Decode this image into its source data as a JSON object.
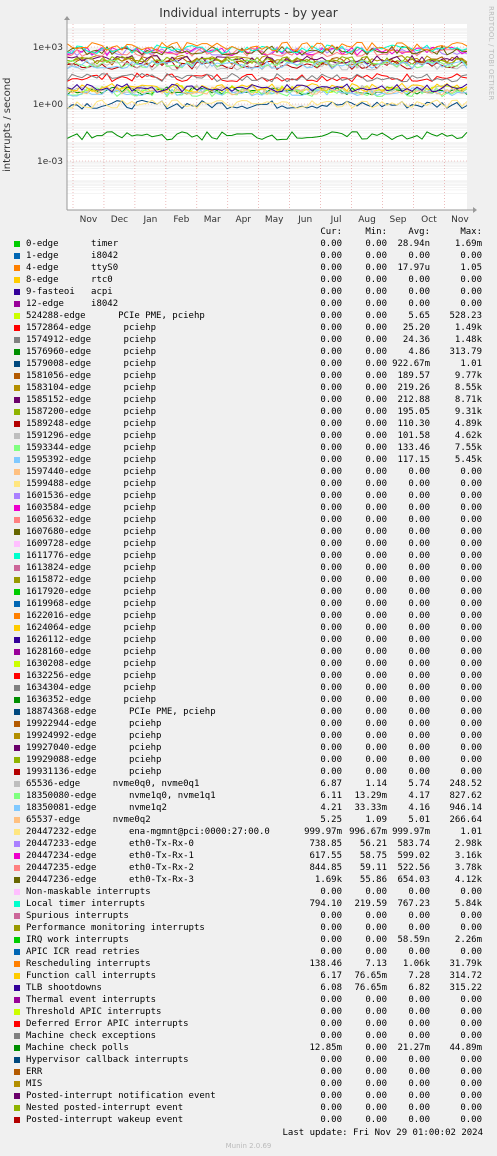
{
  "page": {
    "title": "Individual interrupts - by year",
    "side_text": "RRDTOOL / TOBI OETIKER",
    "last_update": "Last update: Fri Nov 29 01:00:02 2024",
    "munin": "Munin 2.0.69"
  },
  "chart_data": {
    "type": "line",
    "ylabel": "interrupts / second",
    "yscale": "log",
    "yticks": [
      "1e-03",
      "1e+00",
      "1e+03"
    ],
    "xticks": [
      "Nov",
      "Dec",
      "Jan",
      "Feb",
      "Mar",
      "Apr",
      "May",
      "Jun",
      "Jul",
      "Aug",
      "Sep",
      "Oct",
      "Nov"
    ],
    "grid": true,
    "columns": [
      "Cur:",
      "Min:",
      "Avg:",
      "Max:"
    ],
    "series": [
      {
        "name": "0-edge      timer",
        "color": "#00cc00",
        "cur": "0.00",
        "min": "0.00",
        "avg": "28.94n",
        "max": "1.69m"
      },
      {
        "name": "1-edge      i8042",
        "color": "#0066b3",
        "cur": "0.00",
        "min": "0.00",
        "avg": "0.00",
        "max": "0.00"
      },
      {
        "name": "4-edge      ttyS0",
        "color": "#ff8000",
        "cur": "0.00",
        "min": "0.00",
        "avg": "17.97u",
        "max": "1.05"
      },
      {
        "name": "8-edge      rtc0",
        "color": "#ffcc00",
        "cur": "0.00",
        "min": "0.00",
        "avg": "0.00",
        "max": "0.00"
      },
      {
        "name": "9-fasteoi   acpi",
        "color": "#330099",
        "cur": "0.00",
        "min": "0.00",
        "avg": "0.00",
        "max": "0.00"
      },
      {
        "name": "12-edge     i8042",
        "color": "#990099",
        "cur": "0.00",
        "min": "0.00",
        "avg": "0.00",
        "max": "0.00"
      },
      {
        "name": "524288-edge      PCIe PME, pciehp",
        "color": "#ccff00",
        "cur": "0.00",
        "min": "0.00",
        "avg": "5.65",
        "max": "528.23"
      },
      {
        "name": "1572864-edge      pciehp",
        "color": "#ff0000",
        "cur": "0.00",
        "min": "0.00",
        "avg": "25.20",
        "max": "1.49k"
      },
      {
        "name": "1574912-edge      pciehp",
        "color": "#808080",
        "cur": "0.00",
        "min": "0.00",
        "avg": "24.36",
        "max": "1.48k"
      },
      {
        "name": "1576960-edge      pciehp",
        "color": "#008f00",
        "cur": "0.00",
        "min": "0.00",
        "avg": "4.86",
        "max": "313.79"
      },
      {
        "name": "1579008-edge      pciehp",
        "color": "#00487d",
        "cur": "0.00",
        "min": "0.00",
        "avg": "922.67m",
        "max": "1.01"
      },
      {
        "name": "1581056-edge      pciehp",
        "color": "#b35a00",
        "cur": "0.00",
        "min": "0.00",
        "avg": "189.57",
        "max": "9.77k"
      },
      {
        "name": "1583104-edge      pciehp",
        "color": "#b38f00",
        "cur": "0.00",
        "min": "0.00",
        "avg": "219.26",
        "max": "8.55k"
      },
      {
        "name": "1585152-edge      pciehp",
        "color": "#6b006b",
        "cur": "0.00",
        "min": "0.00",
        "avg": "212.88",
        "max": "8.71k"
      },
      {
        "name": "1587200-edge      pciehp",
        "color": "#8fb300",
        "cur": "0.00",
        "min": "0.00",
        "avg": "195.05",
        "max": "9.31k"
      },
      {
        "name": "1589248-edge      pciehp",
        "color": "#b30000",
        "cur": "0.00",
        "min": "0.00",
        "avg": "110.30",
        "max": "4.89k"
      },
      {
        "name": "1591296-edge      pciehp",
        "color": "#bebebe",
        "cur": "0.00",
        "min": "0.00",
        "avg": "101.58",
        "max": "4.62k"
      },
      {
        "name": "1593344-edge      pciehp",
        "color": "#80ff80",
        "cur": "0.00",
        "min": "0.00",
        "avg": "133.46",
        "max": "7.55k"
      },
      {
        "name": "1595392-edge      pciehp",
        "color": "#80c9ff",
        "cur": "0.00",
        "min": "0.00",
        "avg": "117.15",
        "max": "5.45k"
      },
      {
        "name": "1597440-edge      pciehp",
        "color": "#ffc080",
        "cur": "0.00",
        "min": "0.00",
        "avg": "0.00",
        "max": "0.00"
      },
      {
        "name": "1599488-edge      pciehp",
        "color": "#ffe680",
        "cur": "0.00",
        "min": "0.00",
        "avg": "0.00",
        "max": "0.00"
      },
      {
        "name": "1601536-edge      pciehp",
        "color": "#aa80ff",
        "cur": "0.00",
        "min": "0.00",
        "avg": "0.00",
        "max": "0.00"
      },
      {
        "name": "1603584-edge      pciehp",
        "color": "#ee00cc",
        "cur": "0.00",
        "min": "0.00",
        "avg": "0.00",
        "max": "0.00"
      },
      {
        "name": "1605632-edge      pciehp",
        "color": "#ff8080",
        "cur": "0.00",
        "min": "0.00",
        "avg": "0.00",
        "max": "0.00"
      },
      {
        "name": "1607680-edge      pciehp",
        "color": "#666600",
        "cur": "0.00",
        "min": "0.00",
        "avg": "0.00",
        "max": "0.00"
      },
      {
        "name": "1609728-edge      pciehp",
        "color": "#ffbfff",
        "cur": "0.00",
        "min": "0.00",
        "avg": "0.00",
        "max": "0.00"
      },
      {
        "name": "1611776-edge      pciehp",
        "color": "#00ffcc",
        "cur": "0.00",
        "min": "0.00",
        "avg": "0.00",
        "max": "0.00"
      },
      {
        "name": "1613824-edge      pciehp",
        "color": "#cc6699",
        "cur": "0.00",
        "min": "0.00",
        "avg": "0.00",
        "max": "0.00"
      },
      {
        "name": "1615872-edge      pciehp",
        "color": "#999900",
        "cur": "0.00",
        "min": "0.00",
        "avg": "0.00",
        "max": "0.00"
      },
      {
        "name": "1617920-edge      pciehp",
        "color": "#00cc00",
        "cur": "0.00",
        "min": "0.00",
        "avg": "0.00",
        "max": "0.00"
      },
      {
        "name": "1619968-edge      pciehp",
        "color": "#0066b3",
        "cur": "0.00",
        "min": "0.00",
        "avg": "0.00",
        "max": "0.00"
      },
      {
        "name": "1622016-edge      pciehp",
        "color": "#ff8000",
        "cur": "0.00",
        "min": "0.00",
        "avg": "0.00",
        "max": "0.00"
      },
      {
        "name": "1624064-edge      pciehp",
        "color": "#ffcc00",
        "cur": "0.00",
        "min": "0.00",
        "avg": "0.00",
        "max": "0.00"
      },
      {
        "name": "1626112-edge      pciehp",
        "color": "#330099",
        "cur": "0.00",
        "min": "0.00",
        "avg": "0.00",
        "max": "0.00"
      },
      {
        "name": "1628160-edge      pciehp",
        "color": "#990099",
        "cur": "0.00",
        "min": "0.00",
        "avg": "0.00",
        "max": "0.00"
      },
      {
        "name": "1630208-edge      pciehp",
        "color": "#ccff00",
        "cur": "0.00",
        "min": "0.00",
        "avg": "0.00",
        "max": "0.00"
      },
      {
        "name": "1632256-edge      pciehp",
        "color": "#ff0000",
        "cur": "0.00",
        "min": "0.00",
        "avg": "0.00",
        "max": "0.00"
      },
      {
        "name": "1634304-edge      pciehp",
        "color": "#808080",
        "cur": "0.00",
        "min": "0.00",
        "avg": "0.00",
        "max": "0.00"
      },
      {
        "name": "1636352-edge      pciehp",
        "color": "#008f00",
        "cur": "0.00",
        "min": "0.00",
        "avg": "0.00",
        "max": "0.00"
      },
      {
        "name": "18874368-edge      PCIe PME, pciehp",
        "color": "#00487d",
        "cur": "0.00",
        "min": "0.00",
        "avg": "0.00",
        "max": "0.00"
      },
      {
        "name": "19922944-edge      pciehp",
        "color": "#b35a00",
        "cur": "0.00",
        "min": "0.00",
        "avg": "0.00",
        "max": "0.00"
      },
      {
        "name": "19924992-edge      pciehp",
        "color": "#b38f00",
        "cur": "0.00",
        "min": "0.00",
        "avg": "0.00",
        "max": "0.00"
      },
      {
        "name": "19927040-edge      pciehp",
        "color": "#6b006b",
        "cur": "0.00",
        "min": "0.00",
        "avg": "0.00",
        "max": "0.00"
      },
      {
        "name": "19929088-edge      pciehp",
        "color": "#8fb300",
        "cur": "0.00",
        "min": "0.00",
        "avg": "0.00",
        "max": "0.00"
      },
      {
        "name": "19931136-edge      pciehp",
        "color": "#b30000",
        "cur": "0.00",
        "min": "0.00",
        "avg": "0.00",
        "max": "0.00"
      },
      {
        "name": "65536-edge      nvme0q0, nvme0q1",
        "color": "#bebebe",
        "cur": "6.87",
        "min": "1.14",
        "avg": "5.74",
        "max": "248.52"
      },
      {
        "name": "18350080-edge      nvme1q0, nvme1q1",
        "color": "#80ff80",
        "cur": "6.11",
        "min": "13.29m",
        "avg": "4.17",
        "max": "827.62"
      },
      {
        "name": "18350081-edge      nvme1q2",
        "color": "#80c9ff",
        "cur": "4.21",
        "min": "33.33m",
        "avg": "4.16",
        "max": "946.14"
      },
      {
        "name": "65537-edge      nvme0q2",
        "color": "#ffc080",
        "cur": "5.25",
        "min": "1.09",
        "avg": "5.01",
        "max": "266.64"
      },
      {
        "name": "20447232-edge      ena-mgmnt@pci:0000:27:00.0",
        "color": "#ffe680",
        "cur": "999.97m",
        "min": "996.67m",
        "avg": "999.97m",
        "max": "1.01"
      },
      {
        "name": "20447233-edge      eth0-Tx-Rx-0",
        "color": "#aa80ff",
        "cur": "738.85",
        "min": "56.21",
        "avg": "583.74",
        "max": "2.98k"
      },
      {
        "name": "20447234-edge      eth0-Tx-Rx-1",
        "color": "#ee00cc",
        "cur": "617.55",
        "min": "58.75",
        "avg": "599.02",
        "max": "3.16k"
      },
      {
        "name": "20447235-edge      eth0-Tx-Rx-2",
        "color": "#ff8080",
        "cur": "844.85",
        "min": "59.11",
        "avg": "522.56",
        "max": "3.78k"
      },
      {
        "name": "20447236-edge      eth0-Tx-Rx-3",
        "color": "#666600",
        "cur": "1.69k",
        "min": "55.86",
        "avg": "654.03",
        "max": "4.12k"
      },
      {
        "name": "Non-maskable interrupts",
        "color": "#ffbfff",
        "cur": "0.00",
        "min": "0.00",
        "avg": "0.00",
        "max": "0.00"
      },
      {
        "name": "Local timer interrupts",
        "color": "#00ffcc",
        "cur": "794.10",
        "min": "219.59",
        "avg": "767.23",
        "max": "5.84k"
      },
      {
        "name": "Spurious interrupts",
        "color": "#cc6699",
        "cur": "0.00",
        "min": "0.00",
        "avg": "0.00",
        "max": "0.00"
      },
      {
        "name": "Performance monitoring interrupts",
        "color": "#999900",
        "cur": "0.00",
        "min": "0.00",
        "avg": "0.00",
        "max": "0.00"
      },
      {
        "name": "IRQ work interrupts",
        "color": "#00cc00",
        "cur": "0.00",
        "min": "0.00",
        "avg": "58.59n",
        "max": "2.26m"
      },
      {
        "name": "APIC ICR read retries",
        "color": "#0066b3",
        "cur": "0.00",
        "min": "0.00",
        "avg": "0.00",
        "max": "0.00"
      },
      {
        "name": "Rescheduling interrupts",
        "color": "#ff8000",
        "cur": "138.46",
        "min": "7.13",
        "avg": "1.06k",
        "max": "31.79k"
      },
      {
        "name": "Function call interrupts",
        "color": "#ffcc00",
        "cur": "6.17",
        "min": "76.65m",
        "avg": "7.28",
        "max": "314.72"
      },
      {
        "name": "TLB shootdowns",
        "color": "#330099",
        "cur": "6.08",
        "min": "76.65m",
        "avg": "6.82",
        "max": "315.22"
      },
      {
        "name": "Thermal event interrupts",
        "color": "#990099",
        "cur": "0.00",
        "min": "0.00",
        "avg": "0.00",
        "max": "0.00"
      },
      {
        "name": "Threshold APIC interrupts",
        "color": "#ccff00",
        "cur": "0.00",
        "min": "0.00",
        "avg": "0.00",
        "max": "0.00"
      },
      {
        "name": "Deferred Error APIC interrupts",
        "color": "#ff0000",
        "cur": "0.00",
        "min": "0.00",
        "avg": "0.00",
        "max": "0.00"
      },
      {
        "name": "Machine check exceptions",
        "color": "#808080",
        "cur": "0.00",
        "min": "0.00",
        "avg": "0.00",
        "max": "0.00"
      },
      {
        "name": "Machine check polls",
        "color": "#008f00",
        "cur": "12.85m",
        "min": "0.00",
        "avg": "21.27m",
        "max": "44.89m"
      },
      {
        "name": "Hypervisor callback interrupts",
        "color": "#00487d",
        "cur": "0.00",
        "min": "0.00",
        "avg": "0.00",
        "max": "0.00"
      },
      {
        "name": "ERR",
        "color": "#b35a00",
        "cur": "0.00",
        "min": "0.00",
        "avg": "0.00",
        "max": "0.00"
      },
      {
        "name": "MIS",
        "color": "#b38f00",
        "cur": "0.00",
        "min": "0.00",
        "avg": "0.00",
        "max": "0.00"
      },
      {
        "name": "Posted-interrupt notification event",
        "color": "#6b006b",
        "cur": "0.00",
        "min": "0.00",
        "avg": "0.00",
        "max": "0.00"
      },
      {
        "name": "Nested posted-interrupt event",
        "color": "#8fb300",
        "cur": "0.00",
        "min": "0.00",
        "avg": "0.00",
        "max": "0.00"
      },
      {
        "name": "Posted-interrupt wakeup event",
        "color": "#b30000",
        "cur": "0.00",
        "min": "0.00",
        "avg": "0.00",
        "max": "0.00"
      }
    ]
  }
}
